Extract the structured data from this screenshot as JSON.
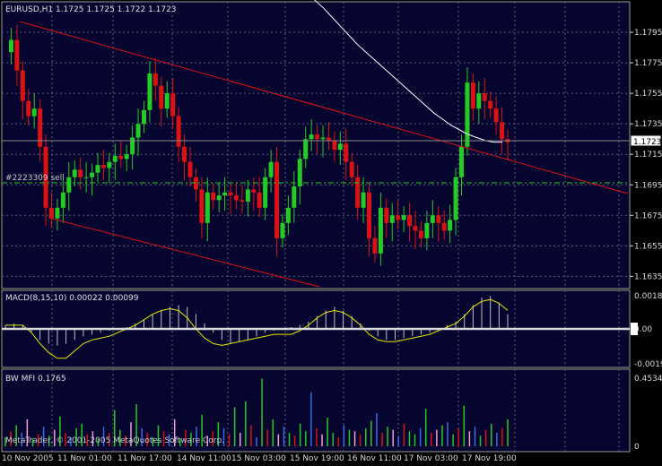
{
  "header": {
    "title": "EURUSD,H1  1.1725 1.1725 1.1722 1.1723",
    "order_label": "#2223309 sell",
    "price_badge": "1.1723",
    "copyright": "MetaTrader, © 2001-2005 MetaQuotes Software Corp."
  },
  "colors": {
    "background": "#000000",
    "panel": "#050530",
    "grid": "#5a5a7a",
    "bull": "#22cc22",
    "bear": "#dd1111",
    "trend": "#dd1111",
    "ma": "#ffffff",
    "order": "#22cc22",
    "macd_signal": "#e6e600",
    "macd_hist": "#c0c0c0",
    "mfi_colors": [
      "#22cc22",
      "#dd1111",
      "#3b6bdc",
      "#f0a0d0"
    ]
  },
  "chart_data": [
    {
      "type": "candlestick",
      "title": "EURUSD,H1  1.1725 1.1725 1.1722 1.1723",
      "x_tick_labels": [
        "10 Nov 2005",
        "11 Nov 01:00",
        "11 Nov 17:00",
        "14 Nov 11:00",
        "15 Nov 03:00",
        "15 Nov 19:00",
        "16 Nov 11:00",
        "17 Nov 03:00",
        "17 Nov 19:00"
      ],
      "y_tick_labels": [
        "1.1795",
        "1.1775",
        "1.1755",
        "1.1735",
        "1.1715",
        "1.1695",
        "1.1675",
        "1.1655",
        "1.1635"
      ],
      "ylim": [
        1.1627,
        1.1815
      ],
      "last_price": 1.1723,
      "order_price": 1.1697,
      "close": [
        1.1782,
        1.179,
        1.177,
        1.175,
        1.174,
        1.1745,
        1.172,
        1.168,
        1.1673,
        1.168,
        1.169,
        1.17,
        1.1705,
        1.17,
        1.17,
        1.1703,
        1.1708,
        1.1706,
        1.171,
        1.1714,
        1.1712,
        1.1715,
        1.1726,
        1.1735,
        1.1744,
        1.1768,
        1.176,
        1.1745,
        1.1755,
        1.174,
        1.172,
        1.171,
        1.17,
        1.1692,
        1.167,
        1.169,
        1.1685,
        1.1688,
        1.169,
        1.1688,
        1.1685,
        1.1684,
        1.1692,
        1.169,
        1.168,
        1.17,
        1.171,
        1.166,
        1.167,
        1.168,
        1.1694,
        1.1712,
        1.1725,
        1.1728,
        1.1725,
        1.1726,
        1.1724,
        1.1718,
        1.1722,
        1.171,
        1.17,
        1.168,
        1.169,
        1.166,
        1.165,
        1.168,
        1.167,
        1.1675,
        1.1672,
        1.1675,
        1.1668,
        1.1665,
        1.166,
        1.167,
        1.1675,
        1.167,
        1.1665,
        1.1672,
        1.17,
        1.172,
        1.1762,
        1.1745,
        1.1755,
        1.175,
        1.1745,
        1.1736,
        1.1725,
        1.1723
      ],
      "series": [
        {
          "name": "",
          "type": "line",
          "values": [
            1.1863,
            1.1857,
            1.1853,
            1.1849,
            1.1845,
            1.1841,
            1.1836,
            1.1831,
            1.1826,
            1.1821,
            1.1816,
            1.1811,
            1.1805,
            1.1799,
            1.1793,
            1.1787,
            1.1782,
            1.1777,
            1.1772,
            1.1767,
            1.1762,
            1.1757,
            1.1752,
            1.1747,
            1.1742,
            1.1738,
            1.1734,
            1.1731,
            1.1728,
            1.1726,
            1.1724,
            1.1723,
            1.1723
          ]
        }
      ]
    },
    {
      "type": "bar",
      "title": "MACD(8,15,10) 0.00022 0.00099",
      "y_tick_labels": [
        "0.0018",
        "0.00",
        "-0.0019"
      ],
      "ylim": [
        -0.0021,
        0.0021
      ],
      "histogram": [
        0.0002,
        0.0003,
        0.0002,
        -0.0002,
        -0.0006,
        -0.0008,
        -0.0009,
        -0.0008,
        -0.0006,
        -0.0004,
        -0.0003,
        -0.0002,
        -0.0001,
        0.0,
        0.0001,
        0.0003,
        0.0005,
        0.0008,
        0.001,
        0.0012,
        0.0013,
        0.0012,
        0.0008,
        0.0003,
        -0.0002,
        -0.0006,
        -0.0008,
        -0.0007,
        -0.0006,
        -0.0004,
        -0.0002,
        -0.0001,
        0.0,
        0.0001,
        0.0002,
        0.0004,
        0.0007,
        0.001,
        0.0012,
        0.001,
        0.0007,
        0.0003,
        -0.0001,
        -0.0004,
        -0.0006,
        -0.0006,
        -0.0005,
        -0.0004,
        -0.0003,
        -0.0002,
        0.0,
        0.0002,
        0.0004,
        0.0008,
        0.0013,
        0.0017,
        0.0018,
        0.0014,
        0.0008
      ],
      "signal": [
        0.0002,
        0.0002,
        0.0002,
        -0.0002,
        -0.0008,
        -0.0013,
        -0.0016,
        -0.0016,
        -0.0012,
        -0.0008,
        -0.0006,
        -0.0005,
        -0.0004,
        -0.0002,
        0.0,
        0.0002,
        0.0005,
        0.0008,
        0.001,
        0.0011,
        0.001,
        0.0006,
        0.0,
        -0.0005,
        -0.0008,
        -0.0009,
        -0.0008,
        -0.0007,
        -0.0006,
        -0.0005,
        -0.0004,
        -0.0003,
        -0.0003,
        -0.0003,
        -0.0001,
        0.0002,
        0.0006,
        0.0009,
        0.001,
        0.0009,
        0.0006,
        0.0002,
        -0.0003,
        -0.0006,
        -0.0007,
        -0.0007,
        -0.0006,
        -0.0005,
        -0.0004,
        -0.0003,
        -0.0001,
        0.0001,
        0.0003,
        0.0007,
        0.0012,
        0.0015,
        0.0016,
        0.0014,
        0.001
      ]
    },
    {
      "type": "bar",
      "title": "BW MFI 0.1765",
      "y_tick_labels": [
        "0.4534",
        "0"
      ],
      "ylim": [
        0,
        0.4534
      ],
      "values": [
        0.06,
        0.1,
        0.14,
        0.09,
        0.18,
        0.05,
        0.08,
        0.13,
        0.07,
        0.11,
        0.2,
        0.09,
        0.06,
        0.12,
        0.15,
        0.08,
        0.1,
        0.05,
        0.13,
        0.09,
        0.24,
        0.11,
        0.07,
        0.16,
        0.28,
        0.12,
        0.09,
        0.06,
        0.14,
        0.1,
        0.08,
        0.18,
        0.05,
        0.11,
        0.09,
        0.13,
        0.21,
        0.07,
        0.1,
        0.16,
        0.12,
        0.08,
        0.26,
        0.09,
        0.3,
        0.14,
        0.06,
        0.45,
        0.11,
        0.18,
        0.08,
        0.13,
        0.09,
        0.07,
        0.15,
        0.1,
        0.36,
        0.12,
        0.08,
        0.19,
        0.09,
        0.06,
        0.14,
        0.11,
        0.1,
        0.08,
        0.12,
        0.17,
        0.22,
        0.09,
        0.13,
        0.11,
        0.07,
        0.15,
        0.1,
        0.08,
        0.12,
        0.25,
        0.09,
        0.11,
        0.14,
        0.16,
        0.08,
        0.12,
        0.27,
        0.1,
        0.13,
        0.07,
        0.11,
        0.15,
        0.09,
        0.12,
        0.18
      ],
      "mfi_color_index": [
        0,
        1,
        0,
        2,
        3,
        0,
        1,
        2,
        0,
        3,
        0,
        1,
        2,
        0,
        0,
        1,
        3,
        0,
        2,
        1,
        0,
        0,
        1,
        3,
        0,
        2,
        1,
        0,
        0,
        1,
        2,
        3,
        0,
        1,
        0,
        2,
        0,
        3,
        1,
        0,
        2,
        1,
        0,
        3,
        0,
        1,
        2,
        0,
        1,
        0,
        3,
        2,
        0,
        1,
        0,
        0,
        2,
        1,
        3,
        0,
        0,
        1,
        2,
        0,
        3,
        1,
        0,
        0,
        2,
        1,
        0,
        3,
        2,
        1,
        0,
        0,
        2,
        0,
        1,
        3,
        0,
        2,
        0,
        1,
        0,
        3,
        2,
        0,
        1,
        0,
        2,
        1,
        0
      ]
    }
  ]
}
